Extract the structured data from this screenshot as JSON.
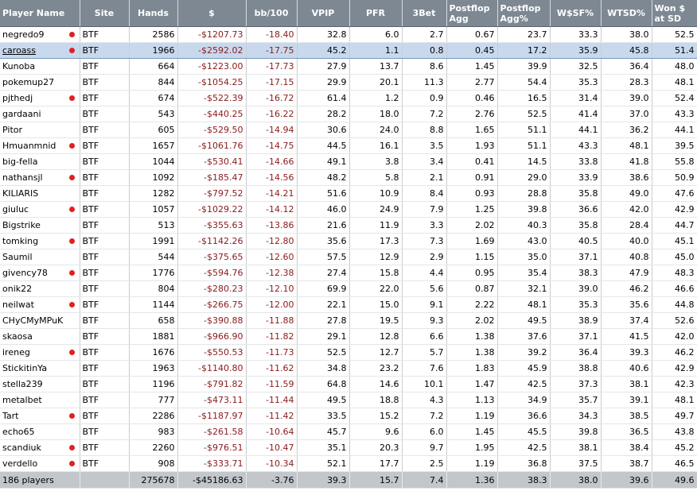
{
  "columns": [
    "Player Name",
    "Site",
    "Hands",
    "$",
    "bb/100",
    "VPIP",
    "PFR",
    "3Bet",
    "Postflop\nAgg",
    "Postflop\nAgg%",
    "W$SF%",
    "WTSD%",
    "Won $\nat SD"
  ],
  "rows": [
    {
      "name": "negredo9",
      "marked": true,
      "site": "BTF",
      "hands": "2586",
      "dollars": "-$1207.73",
      "bb": "-18.40",
      "vpip": "32.8",
      "pfr": "6.0",
      "threebet": "2.7",
      "pagg": "0.67",
      "paggpct": "23.7",
      "wsf": "33.3",
      "wtsd": "38.0",
      "wsd": "52.5"
    },
    {
      "name": "caroass",
      "marked": true,
      "selected": true,
      "site": "BTF",
      "hands": "1966",
      "dollars": "-$2592.02",
      "bb": "-17.75",
      "vpip": "45.2",
      "pfr": "1.1",
      "threebet": "0.8",
      "pagg": "0.45",
      "paggpct": "17.2",
      "wsf": "35.9",
      "wtsd": "45.8",
      "wsd": "51.4"
    },
    {
      "name": "Kunoba",
      "marked": false,
      "site": "BTF",
      "hands": "664",
      "dollars": "-$1223.00",
      "bb": "-17.73",
      "vpip": "27.9",
      "pfr": "13.7",
      "threebet": "8.6",
      "pagg": "1.45",
      "paggpct": "39.9",
      "wsf": "32.5",
      "wtsd": "36.4",
      "wsd": "48.0"
    },
    {
      "name": "pokemup27",
      "marked": false,
      "site": "BTF",
      "hands": "844",
      "dollars": "-$1054.25",
      "bb": "-17.15",
      "vpip": "29.9",
      "pfr": "20.1",
      "threebet": "11.3",
      "pagg": "2.77",
      "paggpct": "54.4",
      "wsf": "35.3",
      "wtsd": "28.3",
      "wsd": "48.1"
    },
    {
      "name": "pjthedj",
      "marked": true,
      "site": "BTF",
      "hands": "674",
      "dollars": "-$522.39",
      "bb": "-16.72",
      "vpip": "61.4",
      "pfr": "1.2",
      "threebet": "0.9",
      "pagg": "0.46",
      "paggpct": "16.5",
      "wsf": "31.4",
      "wtsd": "39.0",
      "wsd": "52.4"
    },
    {
      "name": "gardaani",
      "marked": false,
      "site": "BTF",
      "hands": "543",
      "dollars": "-$440.25",
      "bb": "-16.22",
      "vpip": "28.2",
      "pfr": "18.0",
      "threebet": "7.2",
      "pagg": "2.76",
      "paggpct": "52.5",
      "wsf": "41.4",
      "wtsd": "37.0",
      "wsd": "43.3"
    },
    {
      "name": "Pitor",
      "marked": false,
      "site": "BTF",
      "hands": "605",
      "dollars": "-$529.50",
      "bb": "-14.94",
      "vpip": "30.6",
      "pfr": "24.0",
      "threebet": "8.8",
      "pagg": "1.65",
      "paggpct": "51.1",
      "wsf": "44.1",
      "wtsd": "36.2",
      "wsd": "44.1"
    },
    {
      "name": "Hmuanmnid",
      "marked": true,
      "site": "BTF",
      "hands": "1657",
      "dollars": "-$1061.76",
      "bb": "-14.75",
      "vpip": "44.5",
      "pfr": "16.1",
      "threebet": "3.5",
      "pagg": "1.93",
      "paggpct": "51.1",
      "wsf": "43.3",
      "wtsd": "48.1",
      "wsd": "39.5"
    },
    {
      "name": "big-fella",
      "marked": false,
      "site": "BTF",
      "hands": "1044",
      "dollars": "-$530.41",
      "bb": "-14.66",
      "vpip": "49.1",
      "pfr": "3.8",
      "threebet": "3.4",
      "pagg": "0.41",
      "paggpct": "14.5",
      "wsf": "33.8",
      "wtsd": "41.8",
      "wsd": "55.8"
    },
    {
      "name": "nathansjl",
      "marked": true,
      "site": "BTF",
      "hands": "1092",
      "dollars": "-$185.47",
      "bb": "-14.56",
      "vpip": "48.2",
      "pfr": "5.8",
      "threebet": "2.1",
      "pagg": "0.91",
      "paggpct": "29.0",
      "wsf": "33.9",
      "wtsd": "38.6",
      "wsd": "50.9"
    },
    {
      "name": "KILIARIS",
      "marked": false,
      "site": "BTF",
      "hands": "1282",
      "dollars": "-$797.52",
      "bb": "-14.21",
      "vpip": "51.6",
      "pfr": "10.9",
      "threebet": "8.4",
      "pagg": "0.93",
      "paggpct": "28.8",
      "wsf": "35.8",
      "wtsd": "49.0",
      "wsd": "47.6"
    },
    {
      "name": "giuluc",
      "marked": true,
      "site": "BTF",
      "hands": "1057",
      "dollars": "-$1029.22",
      "bb": "-14.12",
      "vpip": "46.0",
      "pfr": "24.9",
      "threebet": "7.9",
      "pagg": "1.25",
      "paggpct": "39.8",
      "wsf": "36.6",
      "wtsd": "42.0",
      "wsd": "42.9"
    },
    {
      "name": "Bigstrike",
      "marked": false,
      "site": "BTF",
      "hands": "513",
      "dollars": "-$355.63",
      "bb": "-13.86",
      "vpip": "21.6",
      "pfr": "11.9",
      "threebet": "3.3",
      "pagg": "2.02",
      "paggpct": "40.3",
      "wsf": "35.8",
      "wtsd": "28.4",
      "wsd": "44.7"
    },
    {
      "name": "tomking",
      "marked": true,
      "site": "BTF",
      "hands": "1991",
      "dollars": "-$1142.26",
      "bb": "-12.80",
      "vpip": "35.6",
      "pfr": "17.3",
      "threebet": "7.3",
      "pagg": "1.69",
      "paggpct": "43.0",
      "wsf": "40.5",
      "wtsd": "40.0",
      "wsd": "45.1"
    },
    {
      "name": "Saumil",
      "marked": false,
      "site": "BTF",
      "hands": "544",
      "dollars": "-$375.65",
      "bb": "-12.60",
      "vpip": "57.5",
      "pfr": "12.9",
      "threebet": "2.9",
      "pagg": "1.15",
      "paggpct": "35.0",
      "wsf": "37.1",
      "wtsd": "40.8",
      "wsd": "45.0"
    },
    {
      "name": "givency78",
      "marked": true,
      "site": "BTF",
      "hands": "1776",
      "dollars": "-$594.76",
      "bb": "-12.38",
      "vpip": "27.4",
      "pfr": "15.8",
      "threebet": "4.4",
      "pagg": "0.95",
      "paggpct": "35.4",
      "wsf": "38.3",
      "wtsd": "47.9",
      "wsd": "48.3"
    },
    {
      "name": "onik22",
      "marked": false,
      "site": "BTF",
      "hands": "804",
      "dollars": "-$280.23",
      "bb": "-12.10",
      "vpip": "69.9",
      "pfr": "22.0",
      "threebet": "5.6",
      "pagg": "0.87",
      "paggpct": "32.1",
      "wsf": "39.0",
      "wtsd": "46.2",
      "wsd": "46.6"
    },
    {
      "name": "neilwat",
      "marked": true,
      "site": "BTF",
      "hands": "1144",
      "dollars": "-$266.75",
      "bb": "-12.00",
      "vpip": "22.1",
      "pfr": "15.0",
      "threebet": "9.1",
      "pagg": "2.22",
      "paggpct": "48.1",
      "wsf": "35.3",
      "wtsd": "35.6",
      "wsd": "44.8"
    },
    {
      "name": "CHyCMyMPuK",
      "marked": false,
      "site": "BTF",
      "hands": "658",
      "dollars": "-$390.88",
      "bb": "-11.88",
      "vpip": "27.8",
      "pfr": "19.5",
      "threebet": "9.3",
      "pagg": "2.02",
      "paggpct": "49.5",
      "wsf": "38.9",
      "wtsd": "37.4",
      "wsd": "52.6"
    },
    {
      "name": "skaosa",
      "marked": false,
      "site": "BTF",
      "hands": "1881",
      "dollars": "-$966.90",
      "bb": "-11.82",
      "vpip": "29.1",
      "pfr": "12.8",
      "threebet": "6.6",
      "pagg": "1.38",
      "paggpct": "37.6",
      "wsf": "37.1",
      "wtsd": "41.5",
      "wsd": "42.0"
    },
    {
      "name": "ireneg",
      "marked": true,
      "site": "BTF",
      "hands": "1676",
      "dollars": "-$550.53",
      "bb": "-11.73",
      "vpip": "52.5",
      "pfr": "12.7",
      "threebet": "5.7",
      "pagg": "1.38",
      "paggpct": "39.2",
      "wsf": "36.4",
      "wtsd": "39.3",
      "wsd": "46.2"
    },
    {
      "name": "StickitinYa",
      "marked": false,
      "site": "BTF",
      "hands": "1963",
      "dollars": "-$1140.80",
      "bb": "-11.62",
      "vpip": "34.8",
      "pfr": "23.2",
      "threebet": "7.6",
      "pagg": "1.83",
      "paggpct": "45.9",
      "wsf": "38.8",
      "wtsd": "40.6",
      "wsd": "42.9"
    },
    {
      "name": "stella239",
      "marked": false,
      "site": "BTF",
      "hands": "1196",
      "dollars": "-$791.82",
      "bb": "-11.59",
      "vpip": "64.8",
      "pfr": "14.6",
      "threebet": "10.1",
      "pagg": "1.47",
      "paggpct": "42.5",
      "wsf": "37.3",
      "wtsd": "38.1",
      "wsd": "42.3"
    },
    {
      "name": "metalbet",
      "marked": false,
      "site": "BTF",
      "hands": "777",
      "dollars": "-$473.11",
      "bb": "-11.44",
      "vpip": "49.5",
      "pfr": "18.8",
      "threebet": "4.3",
      "pagg": "1.13",
      "paggpct": "34.9",
      "wsf": "35.7",
      "wtsd": "39.1",
      "wsd": "48.1"
    },
    {
      "name": "Tart",
      "marked": true,
      "site": "BTF",
      "hands": "2286",
      "dollars": "-$1187.97",
      "bb": "-11.42",
      "vpip": "33.5",
      "pfr": "15.2",
      "threebet": "7.2",
      "pagg": "1.19",
      "paggpct": "36.6",
      "wsf": "34.3",
      "wtsd": "38.5",
      "wsd": "49.7"
    },
    {
      "name": "echo65",
      "marked": false,
      "site": "BTF",
      "hands": "983",
      "dollars": "-$261.58",
      "bb": "-10.64",
      "vpip": "45.7",
      "pfr": "9.6",
      "threebet": "6.0",
      "pagg": "1.45",
      "paggpct": "45.5",
      "wsf": "39.8",
      "wtsd": "36.5",
      "wsd": "43.8"
    },
    {
      "name": "scandiuk",
      "marked": true,
      "site": "BTF",
      "hands": "2260",
      "dollars": "-$976.51",
      "bb": "-10.47",
      "vpip": "35.1",
      "pfr": "20.3",
      "threebet": "9.7",
      "pagg": "1.95",
      "paggpct": "42.5",
      "wsf": "38.1",
      "wtsd": "38.4",
      "wsd": "45.2"
    },
    {
      "name": "verdello",
      "marked": true,
      "site": "BTF",
      "hands": "908",
      "dollars": "-$333.71",
      "bb": "-10.34",
      "vpip": "52.1",
      "pfr": "17.7",
      "threebet": "2.5",
      "pagg": "1.19",
      "paggpct": "36.8",
      "wsf": "37.5",
      "wtsd": "38.7",
      "wsd": "46.5"
    }
  ],
  "totals": {
    "name": "186 players",
    "site": "",
    "hands": "275678",
    "dollars": "-$45186.63",
    "bb": "-3.76",
    "vpip": "39.3",
    "pfr": "15.7",
    "threebet": "7.4",
    "pagg": "1.36",
    "paggpct": "38.3",
    "wsf": "38.0",
    "wtsd": "39.6",
    "wsd": "49.6"
  },
  "colors": {
    "header": "#7d8892",
    "selected_row": "#c8d9ee",
    "marker": "#e02020",
    "negative": "#8b1a1a",
    "totals": "#c3c7cc"
  },
  "icons": {
    "marker": "red-dot-icon"
  }
}
